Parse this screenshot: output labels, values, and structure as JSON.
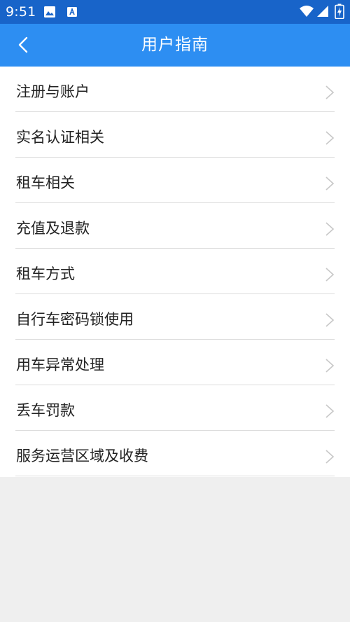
{
  "status_bar": {
    "time": "9:51",
    "icons": [
      "image-icon",
      "a-notification-icon",
      "wifi-icon",
      "signal-icon",
      "battery-charging-icon"
    ],
    "color": "#1864c9"
  },
  "app_bar": {
    "title": "用户指南",
    "back_icon": "chevron-left-icon",
    "color": "#2d8ef2"
  },
  "guide_list": {
    "items": [
      {
        "label": "注册与账户"
      },
      {
        "label": "实名认证相关"
      },
      {
        "label": "租车相关"
      },
      {
        "label": "充值及退款"
      },
      {
        "label": "租车方式"
      },
      {
        "label": "自行车密码锁使用"
      },
      {
        "label": "用车异常处理"
      },
      {
        "label": "丢车罚款"
      },
      {
        "label": "服务运营区域及收费"
      }
    ],
    "item_icon": "chevron-right-icon"
  }
}
